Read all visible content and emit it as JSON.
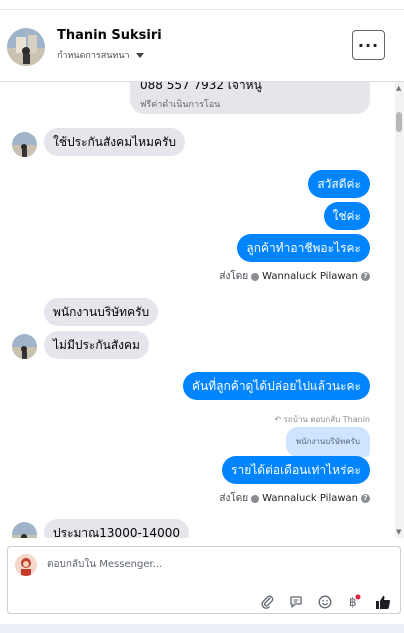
{
  "header": {
    "name": "Thanin Suksiri",
    "subtitle": "กำหนดการสนทนา",
    "more_label": "···"
  },
  "card": {
    "phone": "088 557 7932 เจ้าหนู",
    "sub": "ฟรีค่าดำเนินการโอน"
  },
  "messages": {
    "m1": "ใช้ประกันสังคมไหมครับ",
    "m2": "สวัสดีค่ะ",
    "m3": "ใช่ค่ะ",
    "m4": "ลูกค้าทำอาชีพอะไรคะ",
    "m5": "พนักงานบริษัทครับ",
    "m6": "ไม่มีประกันสังคม",
    "m7": "คันที่ลูกค้าดูได้ปล่อยไปแล้วนะคะ",
    "m8": "รายได้ต่อเดือนเท่าไหร่คะ",
    "m9": "ประมาณ13000-14000"
  },
  "sent_by": {
    "prefix": "ส่งโดย",
    "name": "Wannaluck Pilawan"
  },
  "reply": {
    "label": "↶ รถบ้าน ตอบกลับ Thanin",
    "quoted": "พนักงานบริษัทครับ"
  },
  "composer": {
    "placeholder": "ตอบกลับใน Messenger..."
  },
  "colors": {
    "outgoing": "#0084ff",
    "incoming": "#e4e6eb",
    "quoted": "#cfe4ff"
  },
  "icons": [
    "paperclip-icon",
    "saved-reply-icon",
    "emoji-icon",
    "baht-icon",
    "thumbs-up-icon"
  ]
}
